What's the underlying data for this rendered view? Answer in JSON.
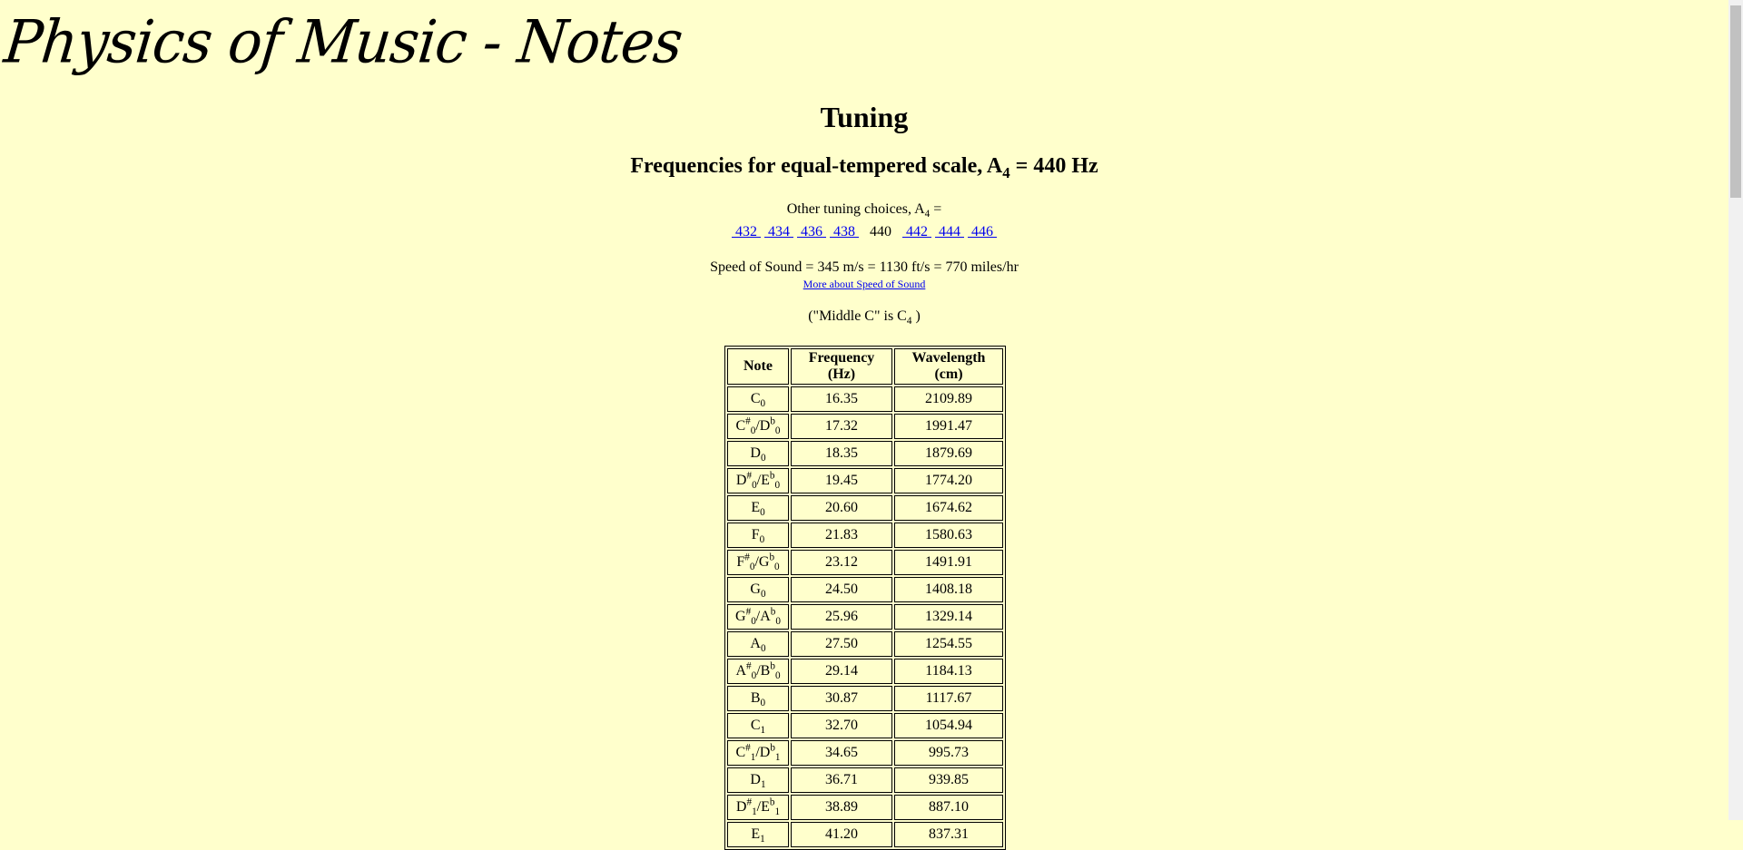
{
  "banner": "Physics of Music - Notes",
  "heading": "Tuning",
  "subheading": {
    "before": "Frequencies for equal-tempered scale, A",
    "sub": "4",
    "after": " = 440 Hz"
  },
  "other_tuning": {
    "before": "Other tuning choices, A",
    "sub": "4",
    "after": " ="
  },
  "tuning_choices": [
    "432",
    "434",
    "436",
    "438",
    "440",
    "442",
    "444",
    "446"
  ],
  "current_tuning": "440",
  "speed": "Speed of Sound = 345 m/s = 1130 ft/s = 770 miles/hr",
  "speed_link": "More about Speed of Sound",
  "middle_c": {
    "before": "(\"Middle C\" is C",
    "sub": "4",
    "after": " )"
  },
  "table": {
    "headers": [
      "Note",
      "Frequency (Hz)",
      "Wavelength (cm)"
    ],
    "rows": [
      {
        "note": "C",
        "oct": "0",
        "alt": null,
        "freq": "16.35",
        "wave": "2109.89"
      },
      {
        "note": "C",
        "oct": "0",
        "alt": "D",
        "freq": "17.32",
        "wave": "1991.47"
      },
      {
        "note": "D",
        "oct": "0",
        "alt": null,
        "freq": "18.35",
        "wave": "1879.69"
      },
      {
        "note": "D",
        "oct": "0",
        "alt": "E",
        "freq": "19.45",
        "wave": "1774.20"
      },
      {
        "note": "E",
        "oct": "0",
        "alt": null,
        "freq": "20.60",
        "wave": "1674.62"
      },
      {
        "note": "F",
        "oct": "0",
        "alt": null,
        "freq": "21.83",
        "wave": "1580.63"
      },
      {
        "note": "F",
        "oct": "0",
        "alt": "G",
        "freq": "23.12",
        "wave": "1491.91"
      },
      {
        "note": "G",
        "oct": "0",
        "alt": null,
        "freq": "24.50",
        "wave": "1408.18"
      },
      {
        "note": "G",
        "oct": "0",
        "alt": "A",
        "freq": "25.96",
        "wave": "1329.14"
      },
      {
        "note": "A",
        "oct": "0",
        "alt": null,
        "freq": "27.50",
        "wave": "1254.55"
      },
      {
        "note": "A",
        "oct": "0",
        "alt": "B",
        "freq": "29.14",
        "wave": "1184.13"
      },
      {
        "note": "B",
        "oct": "0",
        "alt": null,
        "freq": "30.87",
        "wave": "1117.67"
      },
      {
        "note": "C",
        "oct": "1",
        "alt": null,
        "freq": "32.70",
        "wave": "1054.94"
      },
      {
        "note": "C",
        "oct": "1",
        "alt": "D",
        "freq": "34.65",
        "wave": "995.73"
      },
      {
        "note": "D",
        "oct": "1",
        "alt": null,
        "freq": "36.71",
        "wave": "939.85"
      },
      {
        "note": "D",
        "oct": "1",
        "alt": "E",
        "freq": "38.89",
        "wave": "887.10"
      },
      {
        "note": "E",
        "oct": "1",
        "alt": null,
        "freq": "41.20",
        "wave": "837.31"
      }
    ]
  },
  "sharp_symbol": "#",
  "flat_symbol": "b"
}
